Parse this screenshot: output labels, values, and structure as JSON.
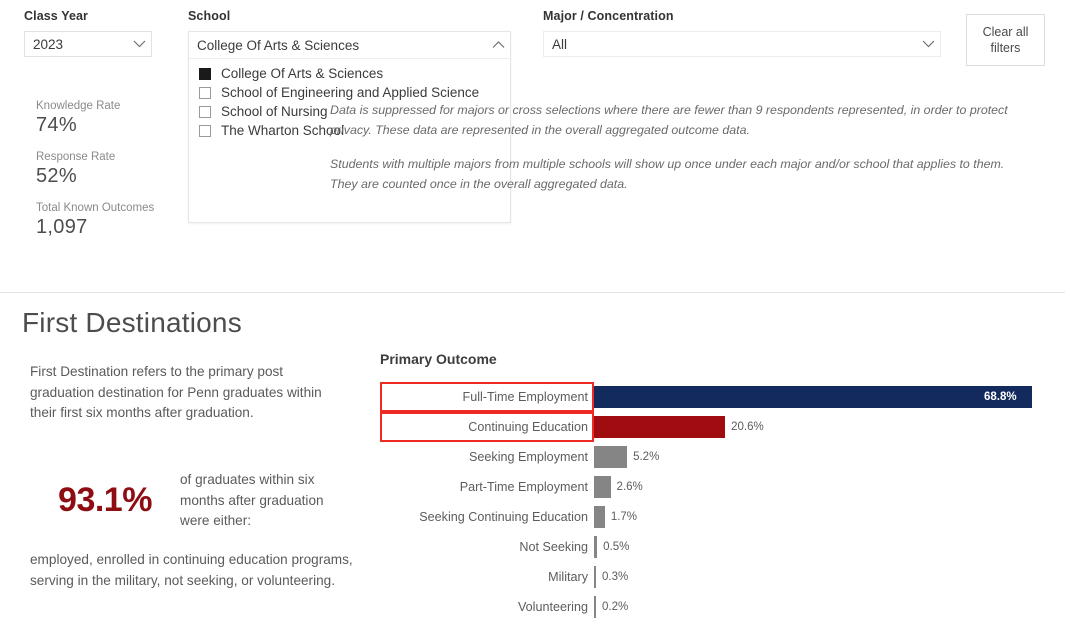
{
  "filters": {
    "class_year": {
      "label": "Class Year",
      "value": "2023",
      "icon": "chevron-down-icon"
    },
    "school": {
      "label": "School",
      "value": "College Of Arts & Sciences",
      "icon": "chevron-up-icon",
      "options": [
        {
          "label": "College Of Arts & Sciences",
          "checked": true
        },
        {
          "label": "School of Engineering and Applied Science",
          "checked": false
        },
        {
          "label": "School of Nursing",
          "checked": false
        },
        {
          "label": "The Wharton School",
          "checked": false
        }
      ]
    },
    "major": {
      "label": "Major / Concentration",
      "value": "All",
      "icon": "chevron-down-icon"
    },
    "clear_all": "Clear all\nfilters"
  },
  "kpis": [
    {
      "label": "Knowledge Rate",
      "value": "74%"
    },
    {
      "label": "Response Rate",
      "value": "52%"
    },
    {
      "label": "Total Known Outcomes",
      "value": "1,097"
    }
  ],
  "footnotes": [
    "Data is suppressed for majors or cross selections where there are fewer than 9 respondents represented, in order to protect privacy. These data are represented in the overall aggregated outcome data.",
    "Students with multiple majors from multiple schools will show up once under each major and/or school that applies to them. They are counted once in the overall aggregated data."
  ],
  "first_destinations": {
    "title": "First Destinations",
    "description": "First Destination refers to the primary post graduation destination for Penn graduates within their first six months after graduation.",
    "hero_percent": "93.1%",
    "hero_text": "of graduates within six months after graduation were either:",
    "tail_text": "employed, enrolled in continuing education programs, serving in the military, not seeking, or volunteering.",
    "hero_color": "#8d0d12"
  },
  "chart_data": {
    "type": "bar",
    "orientation": "horizontal",
    "title": "Primary Outcome",
    "xlabel": "",
    "ylabel": "",
    "xlim": [
      0,
      70
    ],
    "grid": false,
    "legend": false,
    "categories": [
      "Full-Time Employment",
      "Continuing Education",
      "Seeking Employment",
      "Part-Time Employment",
      "Seeking Continuing Education",
      "Not Seeking",
      "Military",
      "Volunteering"
    ],
    "values": [
      68.8,
      20.6,
      5.2,
      2.6,
      1.7,
      0.5,
      0.3,
      0.2
    ],
    "labels": [
      "68.8%",
      "20.6%",
      "5.2%",
      "2.6%",
      "1.7%",
      "0.5%",
      "0.3%",
      "0.2%"
    ],
    "colors": [
      "#132a5e",
      "#a00c10",
      "#858585",
      "#858585",
      "#858585",
      "#858585",
      "#858585",
      "#858585"
    ],
    "label_inside": [
      true,
      false,
      false,
      false,
      false,
      false,
      false,
      false
    ],
    "selected": [
      true,
      true,
      false,
      false,
      false,
      false,
      false,
      false
    ],
    "selection_color": "#ee2b22"
  }
}
